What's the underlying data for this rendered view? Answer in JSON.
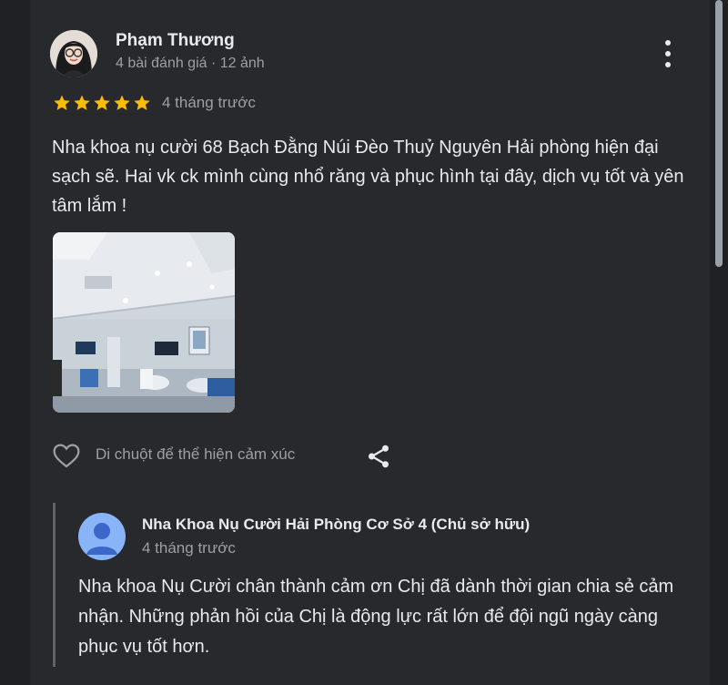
{
  "review": {
    "reviewer_name": "Phạm Thương",
    "reviewer_meta": "4 bài đánh giá · 12 ảnh",
    "rating": 5,
    "time": "4 tháng trước",
    "text": "Nha khoa nụ cười 68 Bạch Đằng Núi Đèo Thuỷ Nguyên Hải phòng hiện đại sạch sẽ. Hai vk ck mình cùng nhổ răng và phục hình tại đây, dịch vụ tốt và yên tâm lắm !",
    "react_label": "Di chuột để thể hiện cảm xúc"
  },
  "owner_reply": {
    "name": "Nha Khoa Nụ Cười Hải Phòng Cơ Sở 4 (Chủ sở hữu)",
    "time": "4 tháng trước",
    "text": "Nha khoa Nụ Cười chân thành cảm ơn Chị đã dành thời gian chia sẻ cảm nhận. Những phản hồi của Chị là động lực rất lớn để đội ngũ ngày càng phục vụ tốt hơn."
  },
  "icons": {
    "more": "more-vert-icon",
    "star": "star-icon",
    "heart": "heart-outline-icon",
    "share": "share-icon",
    "owner_avatar": "person-icon"
  },
  "colors": {
    "star": "#fbbc04",
    "background": "#28292c",
    "text": "#e8eaed",
    "secondary_text": "#9aa0a6",
    "owner_avatar": "#8ab4f8"
  }
}
